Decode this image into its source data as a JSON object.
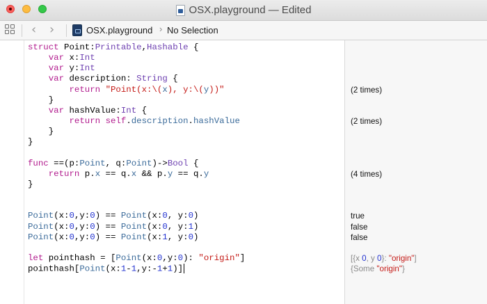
{
  "window": {
    "title": "OSX.playground — Edited"
  },
  "pathbar": {
    "back_glyph": "‹",
    "forward_glyph": "›",
    "crumb_file": "OSX.playground",
    "crumb_separator": "›",
    "crumb_selection": "No Selection"
  },
  "icons": {
    "close": "close-icon",
    "minimize": "minimize-icon",
    "zoom": "zoom-icon",
    "related_items": "grid-icon",
    "back": "chevron-left-icon",
    "forward": "chevron-right-icon",
    "playground": "playground-file-icon"
  },
  "colors": {
    "keyword": "#b21c8e",
    "type": "#6d3fb0",
    "property": "#3b6b9a",
    "number": "#2232d0",
    "string": "#c41a16",
    "results_background": "#f7f7f7"
  },
  "code_lines": [
    [
      {
        "t": "struct",
        "c": "kw"
      },
      {
        "t": " Point:"
      },
      {
        "t": "Printable",
        "c": "ty"
      },
      {
        "t": ","
      },
      {
        "t": "Hashable",
        "c": "ty"
      },
      {
        "t": " {"
      }
    ],
    [
      {
        "t": "    "
      },
      {
        "t": "var",
        "c": "kw"
      },
      {
        "t": " x:"
      },
      {
        "t": "Int",
        "c": "ty"
      }
    ],
    [
      {
        "t": "    "
      },
      {
        "t": "var",
        "c": "kw"
      },
      {
        "t": " y:"
      },
      {
        "t": "Int",
        "c": "ty"
      }
    ],
    [
      {
        "t": "    "
      },
      {
        "t": "var",
        "c": "kw"
      },
      {
        "t": " description: "
      },
      {
        "t": "String",
        "c": "ty"
      },
      {
        "t": " {"
      }
    ],
    [
      {
        "t": "        "
      },
      {
        "t": "return",
        "c": "kw"
      },
      {
        "t": " "
      },
      {
        "t": "\"Point(x:\\(",
        "c": "str"
      },
      {
        "t": "x",
        "c": "pr"
      },
      {
        "t": "), y:\\(",
        "c": "str"
      },
      {
        "t": "y",
        "c": "pr"
      },
      {
        "t": "))\"",
        "c": "str"
      }
    ],
    [
      {
        "t": "    }"
      }
    ],
    [
      {
        "t": "    "
      },
      {
        "t": "var",
        "c": "kw"
      },
      {
        "t": " hashValue:"
      },
      {
        "t": "Int",
        "c": "ty"
      },
      {
        "t": " {"
      }
    ],
    [
      {
        "t": "        "
      },
      {
        "t": "return",
        "c": "kw"
      },
      {
        "t": " "
      },
      {
        "t": "self",
        "c": "kw"
      },
      {
        "t": "."
      },
      {
        "t": "description",
        "c": "pr"
      },
      {
        "t": "."
      },
      {
        "t": "hashValue",
        "c": "pr"
      }
    ],
    [
      {
        "t": "    }"
      }
    ],
    [
      {
        "t": "}"
      }
    ],
    [],
    [
      {
        "t": "func",
        "c": "kw"
      },
      {
        "t": " ==(p:"
      },
      {
        "t": "Point",
        "c": "fn"
      },
      {
        "t": ", q:"
      },
      {
        "t": "Point",
        "c": "fn"
      },
      {
        "t": ")->"
      },
      {
        "t": "Bool",
        "c": "ty"
      },
      {
        "t": " {"
      }
    ],
    [
      {
        "t": "    "
      },
      {
        "t": "return",
        "c": "kw"
      },
      {
        "t": " p."
      },
      {
        "t": "x",
        "c": "pr"
      },
      {
        "t": " == q."
      },
      {
        "t": "x",
        "c": "pr"
      },
      {
        "t": " && p."
      },
      {
        "t": "y",
        "c": "pr"
      },
      {
        "t": " == q."
      },
      {
        "t": "y",
        "c": "pr"
      }
    ],
    [
      {
        "t": "}"
      }
    ],
    [],
    [],
    [
      {
        "t": "Point",
        "c": "fn"
      },
      {
        "t": "(x:"
      },
      {
        "t": "0",
        "c": "num"
      },
      {
        "t": ",y:"
      },
      {
        "t": "0",
        "c": "num"
      },
      {
        "t": ") == "
      },
      {
        "t": "Point",
        "c": "fn"
      },
      {
        "t": "(x:"
      },
      {
        "t": "0",
        "c": "num"
      },
      {
        "t": ", y:"
      },
      {
        "t": "0",
        "c": "num"
      },
      {
        "t": ")"
      }
    ],
    [
      {
        "t": "Point",
        "c": "fn"
      },
      {
        "t": "(x:"
      },
      {
        "t": "0",
        "c": "num"
      },
      {
        "t": ",y:"
      },
      {
        "t": "0",
        "c": "num"
      },
      {
        "t": ") == "
      },
      {
        "t": "Point",
        "c": "fn"
      },
      {
        "t": "(x:"
      },
      {
        "t": "0",
        "c": "num"
      },
      {
        "t": ", y:"
      },
      {
        "t": "1",
        "c": "num"
      },
      {
        "t": ")"
      }
    ],
    [
      {
        "t": "Point",
        "c": "fn"
      },
      {
        "t": "(x:"
      },
      {
        "t": "0",
        "c": "num"
      },
      {
        "t": ",y:"
      },
      {
        "t": "0",
        "c": "num"
      },
      {
        "t": ") == "
      },
      {
        "t": "Point",
        "c": "fn"
      },
      {
        "t": "(x:"
      },
      {
        "t": "1",
        "c": "num"
      },
      {
        "t": ", y:"
      },
      {
        "t": "0",
        "c": "num"
      },
      {
        "t": ")"
      }
    ],
    [],
    [
      {
        "t": "let",
        "c": "kw"
      },
      {
        "t": " pointhash = ["
      },
      {
        "t": "Point",
        "c": "fn"
      },
      {
        "t": "(x:"
      },
      {
        "t": "0",
        "c": "num"
      },
      {
        "t": ",y:"
      },
      {
        "t": "0",
        "c": "num"
      },
      {
        "t": "): "
      },
      {
        "t": "\"origin\"",
        "c": "str"
      },
      {
        "t": "]"
      }
    ],
    [
      {
        "t": "pointhash"
      },
      {
        "t": "["
      },
      {
        "t": "Point",
        "c": "fn"
      },
      {
        "t": "(x:"
      },
      {
        "t": "1",
        "c": "num"
      },
      {
        "t": "-"
      },
      {
        "t": "1",
        "c": "num"
      },
      {
        "t": ",y:-"
      },
      {
        "t": "1",
        "c": "num"
      },
      {
        "t": "+"
      },
      {
        "t": "1",
        "c": "num"
      },
      {
        "t": ")]"
      }
    ]
  ],
  "results": [
    {
      "line": 4,
      "parts": [
        {
          "t": "(2 times)"
        }
      ]
    },
    {
      "line": 7,
      "parts": [
        {
          "t": "(2 times)"
        }
      ]
    },
    {
      "line": 12,
      "parts": [
        {
          "t": "(4 times)"
        }
      ]
    },
    {
      "line": 16,
      "parts": [
        {
          "t": "true"
        }
      ]
    },
    {
      "line": 17,
      "parts": [
        {
          "t": "false"
        }
      ]
    },
    {
      "line": 18,
      "parts": [
        {
          "t": "false"
        }
      ]
    },
    {
      "line": 20,
      "grey": true,
      "parts": [
        {
          "t": "[{x "
        },
        {
          "t": "0",
          "c": "num"
        },
        {
          "t": ", y "
        },
        {
          "t": "0",
          "c": "num"
        },
        {
          "t": "}: "
        },
        {
          "t": "\"origin\"",
          "c": "rstr"
        },
        {
          "t": "]"
        }
      ]
    },
    {
      "line": 21,
      "grey": true,
      "parts": [
        {
          "t": "{Some "
        },
        {
          "t": "\"origin\"",
          "c": "rstr"
        },
        {
          "t": "}"
        }
      ]
    }
  ]
}
